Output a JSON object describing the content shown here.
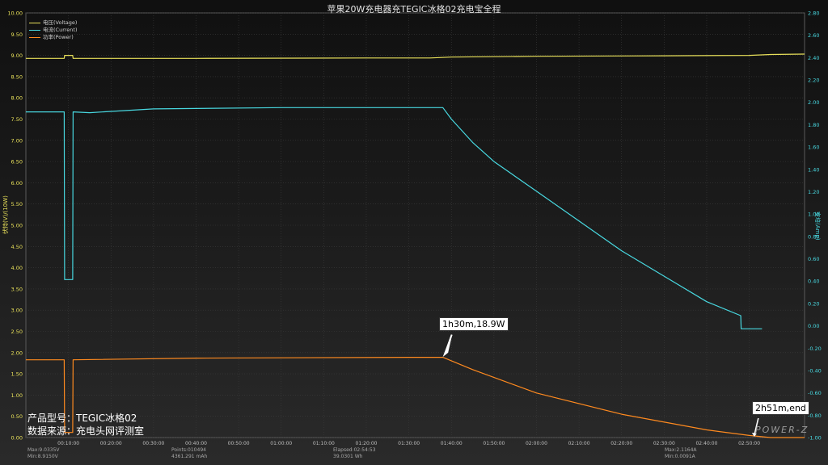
{
  "chart_data": {
    "type": "line",
    "title": "苹果20W充电器充TEGIC冰格02充电宝全程",
    "xlabel": "",
    "ylabel_left": "伏特(V)/(10W)",
    "ylabel_right": "安培(Amp)",
    "x_unit": "minutes",
    "xlim": [
      0,
      183
    ],
    "x_tick_values": [
      10,
      20,
      30,
      40,
      50,
      60,
      70,
      80,
      90,
      100,
      110,
      120,
      130,
      140,
      150,
      160,
      170
    ],
    "x_tick_labels": [
      "00:10:00",
      "00:20:00",
      "00:30:00",
      "00:40:00",
      "00:50:00",
      "01:00:00",
      "01:10:00",
      "01:20:00",
      "01:30:00",
      "01:40:00",
      "01:50:00",
      "02:00:00",
      "02:10:00",
      "02:20:00",
      "02:30:00",
      "02:40:00",
      "02:50:00"
    ],
    "ylim_left": [
      0,
      10
    ],
    "y_left_tick_labels": [
      "0.00",
      "0.50",
      "1.00",
      "1.50",
      "2.00",
      "2.50",
      "3.00",
      "3.50",
      "4.00",
      "4.50",
      "5.00",
      "5.50",
      "6.00",
      "6.50",
      "7.00",
      "7.50",
      "8.00",
      "8.50",
      "9.00",
      "9.50",
      "10.00"
    ],
    "ylim_right": [
      -1,
      2.8
    ],
    "y_right_tick_labels": [
      "-1.00",
      "-0.80",
      "-0.60",
      "-0.40",
      "-0.20",
      "0.00",
      "0.20",
      "0.40",
      "0.60",
      "0.80",
      "1.00",
      "1.20",
      "1.40",
      "1.60",
      "1.80",
      "2.00",
      "2.20",
      "2.40",
      "2.60",
      "2.80"
    ],
    "grid": true,
    "legend_position": "top-left",
    "series": [
      {
        "name": "电压(Voltage)",
        "axis": "left",
        "color": "#e8e05a",
        "x": [
          0,
          9,
          9.1,
          11,
          11.1,
          40,
          80,
          95,
          100,
          120,
          150,
          170,
          175,
          183
        ],
        "y": [
          8.93,
          8.93,
          9.0,
          9.0,
          8.93,
          8.93,
          8.94,
          8.94,
          8.96,
          8.98,
          8.99,
          9.0,
          9.02,
          9.03
        ]
      },
      {
        "name": "电流(Current)",
        "axis": "left",
        "color": "#48d8e0",
        "x": [
          0,
          9,
          9.1,
          11,
          11.1,
          15,
          20,
          30,
          60,
          90,
          98,
          100,
          105,
          110,
          120,
          130,
          140,
          150,
          160,
          168,
          168.1,
          173
        ],
        "y": [
          7.67,
          7.67,
          3.72,
          3.72,
          7.67,
          7.65,
          7.68,
          7.74,
          7.77,
          7.77,
          7.77,
          7.5,
          6.95,
          6.5,
          5.8,
          5.1,
          4.4,
          3.8,
          3.2,
          2.87,
          2.56,
          2.56
        ]
      },
      {
        "name": "功率(Power)",
        "axis": "left",
        "color": "#ff8a1f",
        "x": [
          0,
          9,
          9.1,
          11,
          11.1,
          40,
          90,
          98,
          105,
          120,
          140,
          160,
          170,
          175,
          183
        ],
        "y": [
          1.83,
          1.83,
          0.12,
          0.12,
          1.83,
          1.87,
          1.89,
          1.89,
          1.6,
          1.05,
          0.55,
          0.18,
          0.05,
          0.0,
          0.0
        ]
      }
    ],
    "annotations": [
      {
        "text": "1h30m,18.9W",
        "x": 98,
        "y": 1.89
      },
      {
        "text": "2h51m,end",
        "x": 171,
        "y": 0.0
      }
    ]
  },
  "info": {
    "product": "产品型号：TEGIC冰格02",
    "source": "数据来源：充电头网评测室"
  },
  "brand": "POWER-Z",
  "stats": {
    "max_v": "Max:9.0335V",
    "min_v": "Min:8.9150V",
    "points": "Points:010494",
    "mah": "4361.291 mAh",
    "elapsed": "Elapsed:02:54:53",
    "wh": "39.0301 Wh",
    "max_a": "Max:2.1164A",
    "min_a": "Min:0.0091A"
  }
}
